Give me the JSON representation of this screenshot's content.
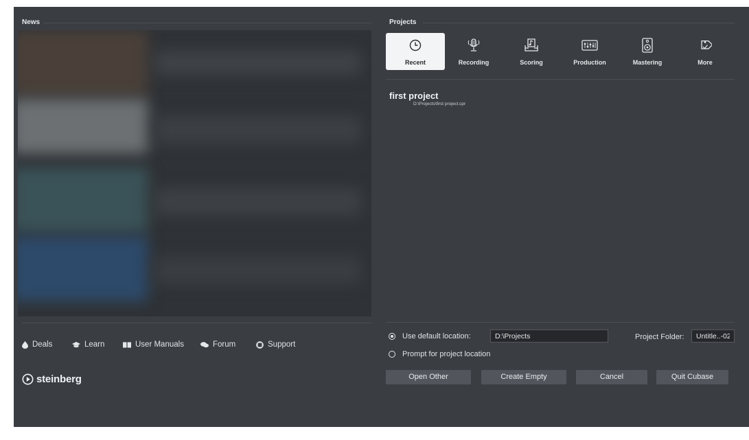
{
  "news": {
    "title": "News",
    "links": [
      {
        "label": "Deals",
        "icon": "droplet-icon"
      },
      {
        "label": "Learn",
        "icon": "graduation-cap-icon"
      },
      {
        "label": "User Manuals",
        "icon": "book-icon"
      },
      {
        "label": "Forum",
        "icon": "chat-bubbles-icon"
      },
      {
        "label": "Support",
        "icon": "lifebuoy-icon"
      }
    ],
    "logo_text": "steinberg"
  },
  "projects": {
    "title": "Projects",
    "categories": [
      {
        "label": "Recent",
        "icon": "clock-icon",
        "active": true
      },
      {
        "label": "Recording",
        "icon": "microphone-icon",
        "active": false
      },
      {
        "label": "Scoring",
        "icon": "score-icon",
        "active": false
      },
      {
        "label": "Production",
        "icon": "mixer-icon",
        "active": false
      },
      {
        "label": "Mastering",
        "icon": "speaker-icon",
        "active": false
      },
      {
        "label": "More",
        "icon": "tag-icon",
        "active": false
      }
    ],
    "recent": [
      {
        "name": "first project",
        "path": "D:\\Projects\\first project.cpr"
      }
    ]
  },
  "location": {
    "use_default_label": "Use default location:",
    "use_default_selected": true,
    "default_path": "D:\\Projects",
    "prompt_label": "Prompt for project location",
    "project_folder_label": "Project Folder:",
    "project_folder_value": "Untitle..-02"
  },
  "buttons": {
    "open_other": "Open Other",
    "create_empty": "Create Empty",
    "cancel": "Cancel",
    "quit": "Quit Cubase"
  },
  "colors": {
    "background": "#3a3d42",
    "active_tile": "#f3f4f5",
    "button": "#52565c"
  }
}
